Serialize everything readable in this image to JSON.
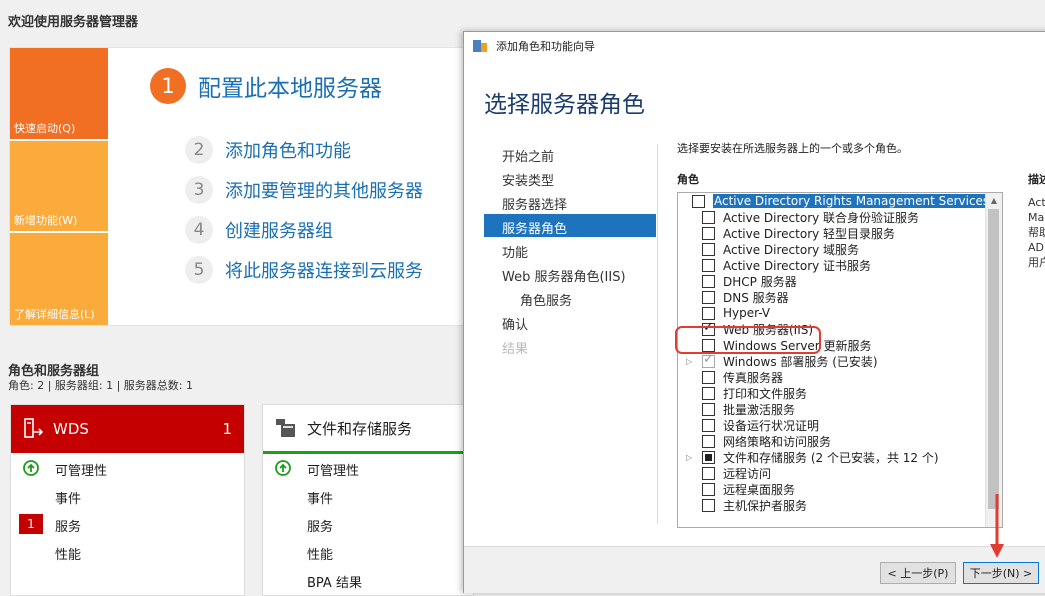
{
  "dashboard": {
    "welcome_title": "欢迎使用服务器管理器",
    "tiles": {
      "quick_start": "快速启动(Q)",
      "whats_new": "新增功能(W)",
      "learn_more": "了解详细信息(L)"
    },
    "steps": [
      {
        "num": "1",
        "label": "配置此本地服务器"
      },
      {
        "num": "2",
        "label": "添加角色和功能"
      },
      {
        "num": "3",
        "label": "添加要管理的其他服务器"
      },
      {
        "num": "4",
        "label": "创建服务器组"
      },
      {
        "num": "5",
        "label": "将此服务器连接到云服务"
      }
    ],
    "roles_title": "角色和服务器组",
    "roles_subtitle": "角色: 2 | 服务器组: 1 | 服务器总数: 1",
    "wds": {
      "name": "WDS",
      "count": "1",
      "rows": [
        "可管理性",
        "事件",
        "服务",
        "性能"
      ],
      "service_badge": "1"
    },
    "file_storage": {
      "name": "文件和存储服务",
      "rows": [
        "可管理性",
        "事件",
        "服务",
        "性能",
        "BPA 结果"
      ]
    }
  },
  "wizard": {
    "title": "添加角色和功能向导",
    "heading": "选择服务器角色",
    "nav": [
      {
        "label": "开始之前"
      },
      {
        "label": "安装类型"
      },
      {
        "label": "服务器选择"
      },
      {
        "label": "服务器角色"
      },
      {
        "label": "功能"
      },
      {
        "label": "Web 服务器角色(IIS)"
      },
      {
        "label": "角色服务"
      },
      {
        "label": "确认"
      },
      {
        "label": "结果"
      }
    ],
    "description_prompt": "选择要安装在所选服务器上的一个或多个角色。",
    "roles_label": "角色",
    "desc_label": "描述",
    "desc_lines": [
      "Act",
      "Ma",
      "帮助",
      "AD",
      "用户"
    ],
    "roles": [
      {
        "label": "Active Directory Rights Management Services",
        "state": "unchecked",
        "selected": true,
        "expander": ""
      },
      {
        "label": "Active Directory 联合身份验证服务",
        "state": "unchecked",
        "selected": false,
        "expander": ""
      },
      {
        "label": "Active Directory 轻型目录服务",
        "state": "unchecked",
        "selected": false,
        "expander": ""
      },
      {
        "label": "Active Directory 域服务",
        "state": "unchecked",
        "selected": false,
        "expander": ""
      },
      {
        "label": "Active Directory 证书服务",
        "state": "unchecked",
        "selected": false,
        "expander": ""
      },
      {
        "label": "DHCP 服务器",
        "state": "unchecked",
        "selected": false,
        "expander": ""
      },
      {
        "label": "DNS 服务器",
        "state": "unchecked",
        "selected": false,
        "expander": ""
      },
      {
        "label": "Hyper-V",
        "state": "unchecked",
        "selected": false,
        "expander": ""
      },
      {
        "label": "Web 服务器(IIS)",
        "state": "checked",
        "selected": false,
        "expander": ""
      },
      {
        "label": "Windows Server 更新服务",
        "state": "unchecked",
        "selected": false,
        "expander": ""
      },
      {
        "label": "Windows 部署服务 (已安装)",
        "state": "grey",
        "selected": false,
        "expander": "▷"
      },
      {
        "label": "传真服务器",
        "state": "unchecked",
        "selected": false,
        "expander": ""
      },
      {
        "label": "打印和文件服务",
        "state": "unchecked",
        "selected": false,
        "expander": ""
      },
      {
        "label": "批量激活服务",
        "state": "unchecked",
        "selected": false,
        "expander": ""
      },
      {
        "label": "设备运行状况证明",
        "state": "unchecked",
        "selected": false,
        "expander": ""
      },
      {
        "label": "网络策略和访问服务",
        "state": "unchecked",
        "selected": false,
        "expander": ""
      },
      {
        "label": "文件和存储服务 (2 个已安装，共 12 个)",
        "state": "partial",
        "selected": false,
        "expander": "▷"
      },
      {
        "label": "远程访问",
        "state": "unchecked",
        "selected": false,
        "expander": ""
      },
      {
        "label": "远程桌面服务",
        "state": "unchecked",
        "selected": false,
        "expander": ""
      },
      {
        "label": "主机保护者服务",
        "state": "unchecked",
        "selected": false,
        "expander": ""
      }
    ],
    "buttons": {
      "prev": "< 上一步(P)",
      "next": "下一步(N) >"
    }
  },
  "colors": {
    "accent_orange": "#f06f22",
    "tile_yellow": "#fbab3c",
    "wds_red": "#c40000",
    "highlight_red": "#e03c31",
    "selection_blue": "#1e73be"
  }
}
